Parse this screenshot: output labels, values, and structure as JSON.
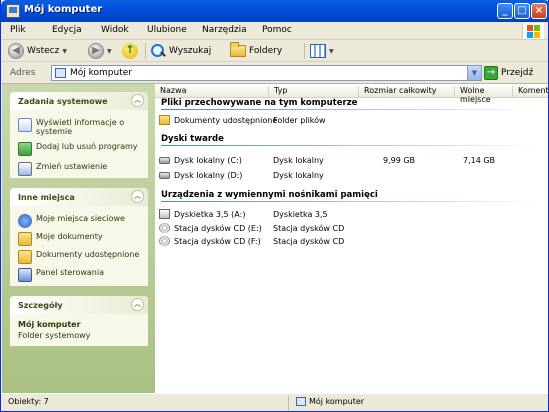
{
  "window": {
    "title": "Mój komputer"
  },
  "menu": [
    "Plik",
    "Edycja",
    "Widok",
    "Ulubione",
    "Narzędzia",
    "Pomoc"
  ],
  "toolbar": {
    "back_label": "Wstecz",
    "search_label": "Wyszukaj",
    "folders_label": "Foldery"
  },
  "address": {
    "label": "Adres",
    "value": "Mój komputer",
    "go_label": "Przejdź"
  },
  "tasks": {
    "system": {
      "title": "Zadania systemowe",
      "items": [
        "Wyświetl informacje o systemie",
        "Dodaj lub usuń programy",
        "Zmień ustawienie"
      ]
    },
    "places": {
      "title": "Inne miejsca",
      "items": [
        "Moje miejsca sieciowe",
        "Moje dokumenty",
        "Dokumenty udostępnione",
        "Panel sterowania"
      ]
    },
    "details": {
      "title": "Szczegóły",
      "name": "Mój komputer",
      "desc": "Folder systemowy"
    }
  },
  "columns": [
    "Nazwa",
    "Typ",
    "Rozmiar całkowity",
    "Wolne miejsce",
    "Komentarze"
  ],
  "groups": {
    "files": {
      "title": "Pliki przechowywane na tym komputerze",
      "items": [
        "Dokumenty udostępnione"
      ],
      "item_types": [
        "Folder plików"
      ]
    },
    "disks": {
      "title": "Dyski twarde",
      "items": [
        {
          "name": "Dysk lokalny (C:)",
          "type": "Dysk lokalny",
          "size": "9,99 GB",
          "free": "7,14 GB"
        },
        {
          "name": "Dysk lokalny (D:)",
          "type": "Dysk lokalny",
          "size": "",
          "free": ""
        }
      ]
    },
    "removable": {
      "title": "Urządzenia z wymiennymi nośnikami pamięci",
      "items": [
        {
          "name": "Dyskietka 3,5 (A:)",
          "type": "Dyskietka 3,5"
        },
        {
          "name": "Stacja dysków CD (E:)",
          "type": "Stacja dysków CD"
        },
        {
          "name": "Stacja dysków CD (F:)",
          "type": "Stacja dysków CD"
        }
      ]
    }
  },
  "status": {
    "left": "Obiekty: 7",
    "right": "Mój komputer"
  }
}
